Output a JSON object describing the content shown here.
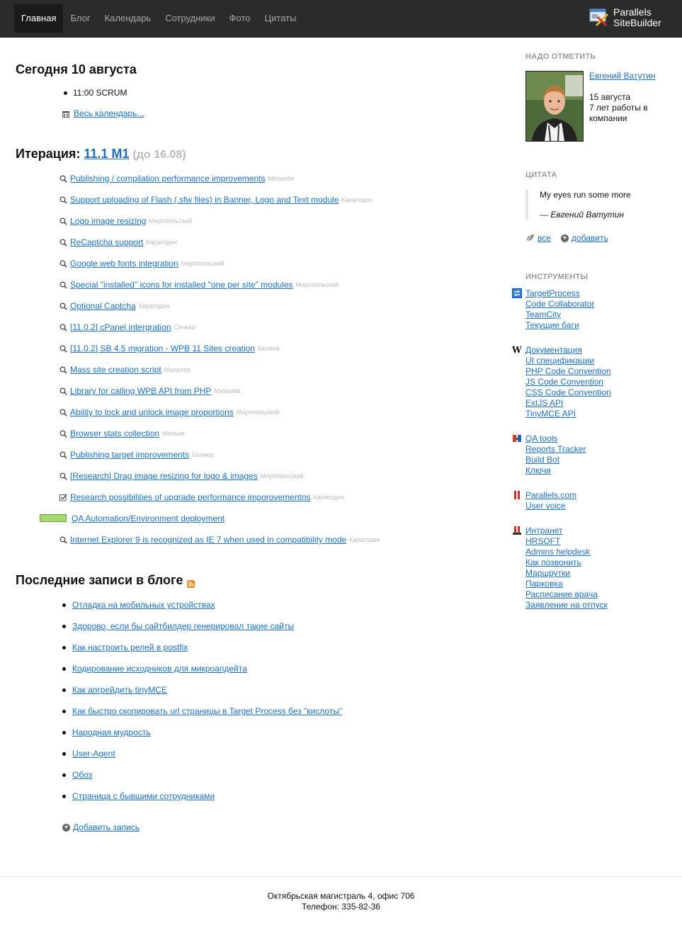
{
  "nav": {
    "items": [
      "Главная",
      "Блог",
      "Календарь",
      "Сотрудники",
      "Фото",
      "Цитаты"
    ],
    "active": "Главная"
  },
  "brand": {
    "line1": "Parallels",
    "line2": "SiteBuilder"
  },
  "today": {
    "title": "Сегодня 10 августа",
    "event": "11:00 SCRUM",
    "calendar_link": "Весь календарь..."
  },
  "iteration": {
    "label": "Итерация:",
    "name": "11.1 M1",
    "until": "(до 16.08)",
    "tasks": [
      {
        "title": "Publishing / compilation performance improvements",
        "owner": "Михалёв",
        "icon": "search-icon"
      },
      {
        "title": "Support uploading of Flash (.sfw files) in Banner, Logo and Text module",
        "owner": "Карагодин",
        "icon": "search-icon"
      },
      {
        "title": "Logo image resizing",
        "owner": "Миропольский",
        "icon": "search-icon"
      },
      {
        "title": "ReCaptcha support",
        "owner": "Карагодин",
        "icon": "search-icon"
      },
      {
        "title": "Google web fonts integration",
        "owner": "Миропольский",
        "icon": "search-icon"
      },
      {
        "title": "Special \"installed\" icons for installed \"one per site\" modules",
        "owner": "Миропольский",
        "icon": "search-icon"
      },
      {
        "title": "Optional Captcha",
        "owner": "Карагодин",
        "icon": "search-icon"
      },
      {
        "title": "[11.0.2] cPanel intergration",
        "owner": "Синько",
        "icon": "search-icon"
      },
      {
        "title": "[11.0.2] SB 4.5 migration - WPB 11 Sites creation",
        "owner": "Беляев",
        "icon": "search-icon"
      },
      {
        "title": "Mass site creation script",
        "owner": "Михалёв",
        "icon": "search-icon"
      },
      {
        "title": "Library for calling WPB API from PHP",
        "owner": "Михалёв",
        "icon": "search-icon"
      },
      {
        "title": "Ability to lock and unlock image proportions",
        "owner": "Миропольский",
        "icon": "search-icon"
      },
      {
        "title": "Browser stats collection",
        "owner": "Мильке",
        "icon": "search-icon"
      },
      {
        "title": "Publishing target improvements",
        "owner": "Беляев",
        "icon": "search-icon"
      },
      {
        "title": "[Research] Drag image resizing for logo & images",
        "owner": "Миропольский",
        "icon": "search-icon"
      },
      {
        "title": "Research possibilities of upgrade performance imporovementns",
        "owner": "Карагодин",
        "icon": "checkbox-icon"
      },
      {
        "title": "QA Automation/Environment deployment",
        "owner": "",
        "icon": "progress-bar"
      },
      {
        "title": "Internet Explorer 9 is recognized as IE 7 when used in compatibility mode",
        "owner": "Карагодин",
        "icon": "search-icon"
      }
    ]
  },
  "blog": {
    "title": "Последние записи в блоге",
    "posts": [
      "Отладка на мобильных устройствах",
      "Здорово, если бы сайтбилдер генерировал такие сайты",
      "Как настроить релей в postfix",
      "Кодирование исходников для микроапдейта",
      "Как апгрейдить tinyMCE",
      "Как быстро скопировать url страницы в Target Process без \"кислоты\"",
      "Народная мудрость",
      "User-Agent",
      "Обоз",
      "Страница с бывшими сотрудниками"
    ],
    "add_label": "Добавить запись"
  },
  "sidebar": {
    "notice_title": "Надо отметить",
    "employee": {
      "name": "Евгений Ватутин",
      "date": "15 августа",
      "anniversary": "7 лет работы в компании"
    },
    "quote_title": "Цитата",
    "quote": {
      "text": "My eyes run some more",
      "author": "— Евгений Ватутин",
      "all_label": "все",
      "add_label": "добавить"
    },
    "tools_title": "Инструменты",
    "tool_groups": [
      {
        "icon": "targetprocess-icon",
        "links": [
          "TargetProcess",
          "Code Collaborator",
          "TeamCity",
          "Текущие баги"
        ]
      },
      {
        "icon": "wiki-icon",
        "links": [
          "Документация",
          "UI спецификации",
          "PHP Code Convention",
          "JS Code Convention",
          "CSS Code Convention",
          "ExtJS API",
          "TinyMCE API"
        ]
      },
      {
        "icon": "qa-icon",
        "links": [
          "QA tools",
          "Reports Tracker",
          "Build Bot",
          "Ключи"
        ]
      },
      {
        "icon": "parallels-icon",
        "links": [
          "Parallels.com",
          "User voice"
        ]
      },
      {
        "icon": "intranet-icon",
        "links": [
          "Интранет",
          "HRSOFT",
          "Admins helpdesk",
          "Как позвонить",
          "Маршрутки",
          "Парковка",
          "Расписание врача",
          "Заявление на отпуск"
        ]
      }
    ]
  },
  "footer": {
    "address": "Октябрьская магистраль 4, офис 706",
    "phone": "Телефон: 335-82-36"
  },
  "colors": {
    "link": "#1a6fc4",
    "topbar": "#2b2b2b",
    "progress": "#a8d870",
    "muted": "#bbbbbb"
  }
}
